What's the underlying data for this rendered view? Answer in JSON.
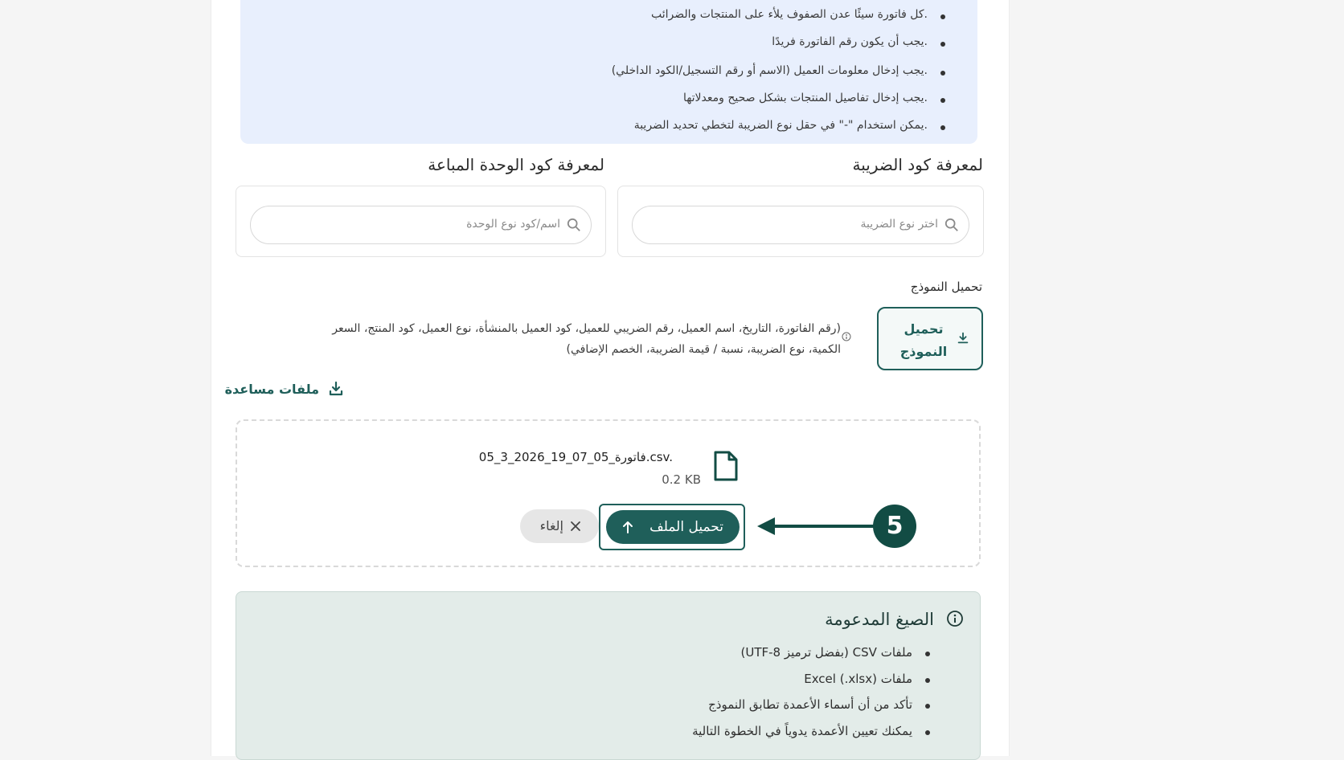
{
  "notes": [
    "كل فاتورة سيئًا عدن الصفوف يلأء على المنتجات والضرائب.",
    "يجب أن يكون رقم الفاتورة فريدًا.",
    "يجب إدخال معلومات العميل (الاسم أو رقم التسجيل/الكود الداخلي).",
    "يجب إدخال تفاصيل المنتجات بشكل صحيح ومعدلاتها.",
    "يمكن استخدام \"-\" في حقل نوع الضريبة لتخطي تحديد الضريبة."
  ],
  "tax_lookup": {
    "title": "لمعرفة كود الضريبة",
    "placeholder": "اختر نوع الضريبة",
    "icon": "search-icon"
  },
  "unit_lookup": {
    "title": "لمعرفة كود الوحدة المباعة",
    "placeholder": "اسم/كود نوع الوحدة",
    "icon": "search-icon"
  },
  "template": {
    "section_label": "تحميل النموذج",
    "button_label": "تحميل النموذج",
    "columns_line1": "(رقم الفاتورة، التاريخ، اسم العميل، رقم الضريبي للعميل، كود العميل بالمنشأة، نوع العميل، كود المنتج، السعر",
    "columns_line2": "الكمية، نوع الضريبة، نسبة / قيمة الضريبة، الخصم الإضافي)"
  },
  "help_files": {
    "label": "ملفات مساعدة",
    "icon": "download-icon"
  },
  "upload": {
    "file_name": "فاتورة_05_07_19_2026_3_05.csv.",
    "file_size": "0.2 KB",
    "upload_label": "تحميل الملف",
    "cancel_label": "إلغاء"
  },
  "callout": {
    "step": "5"
  },
  "formats": {
    "title": "الصيغ المدعومة",
    "items": [
      "ملفات CSV (بفضل ترميز UTF-8)",
      "ملفات Excel (.xlsx)",
      "تأكد من أن أسماء الأعمدة تطابق النموذج",
      "يمكنك تعيين الأعمدة يدوياً في الخطوة التالية"
    ]
  },
  "colors": {
    "primary": "#1f5f5a",
    "badge": "#124c44",
    "notes_bg": "#e8effd",
    "formats_bg": "#e3ece9"
  }
}
